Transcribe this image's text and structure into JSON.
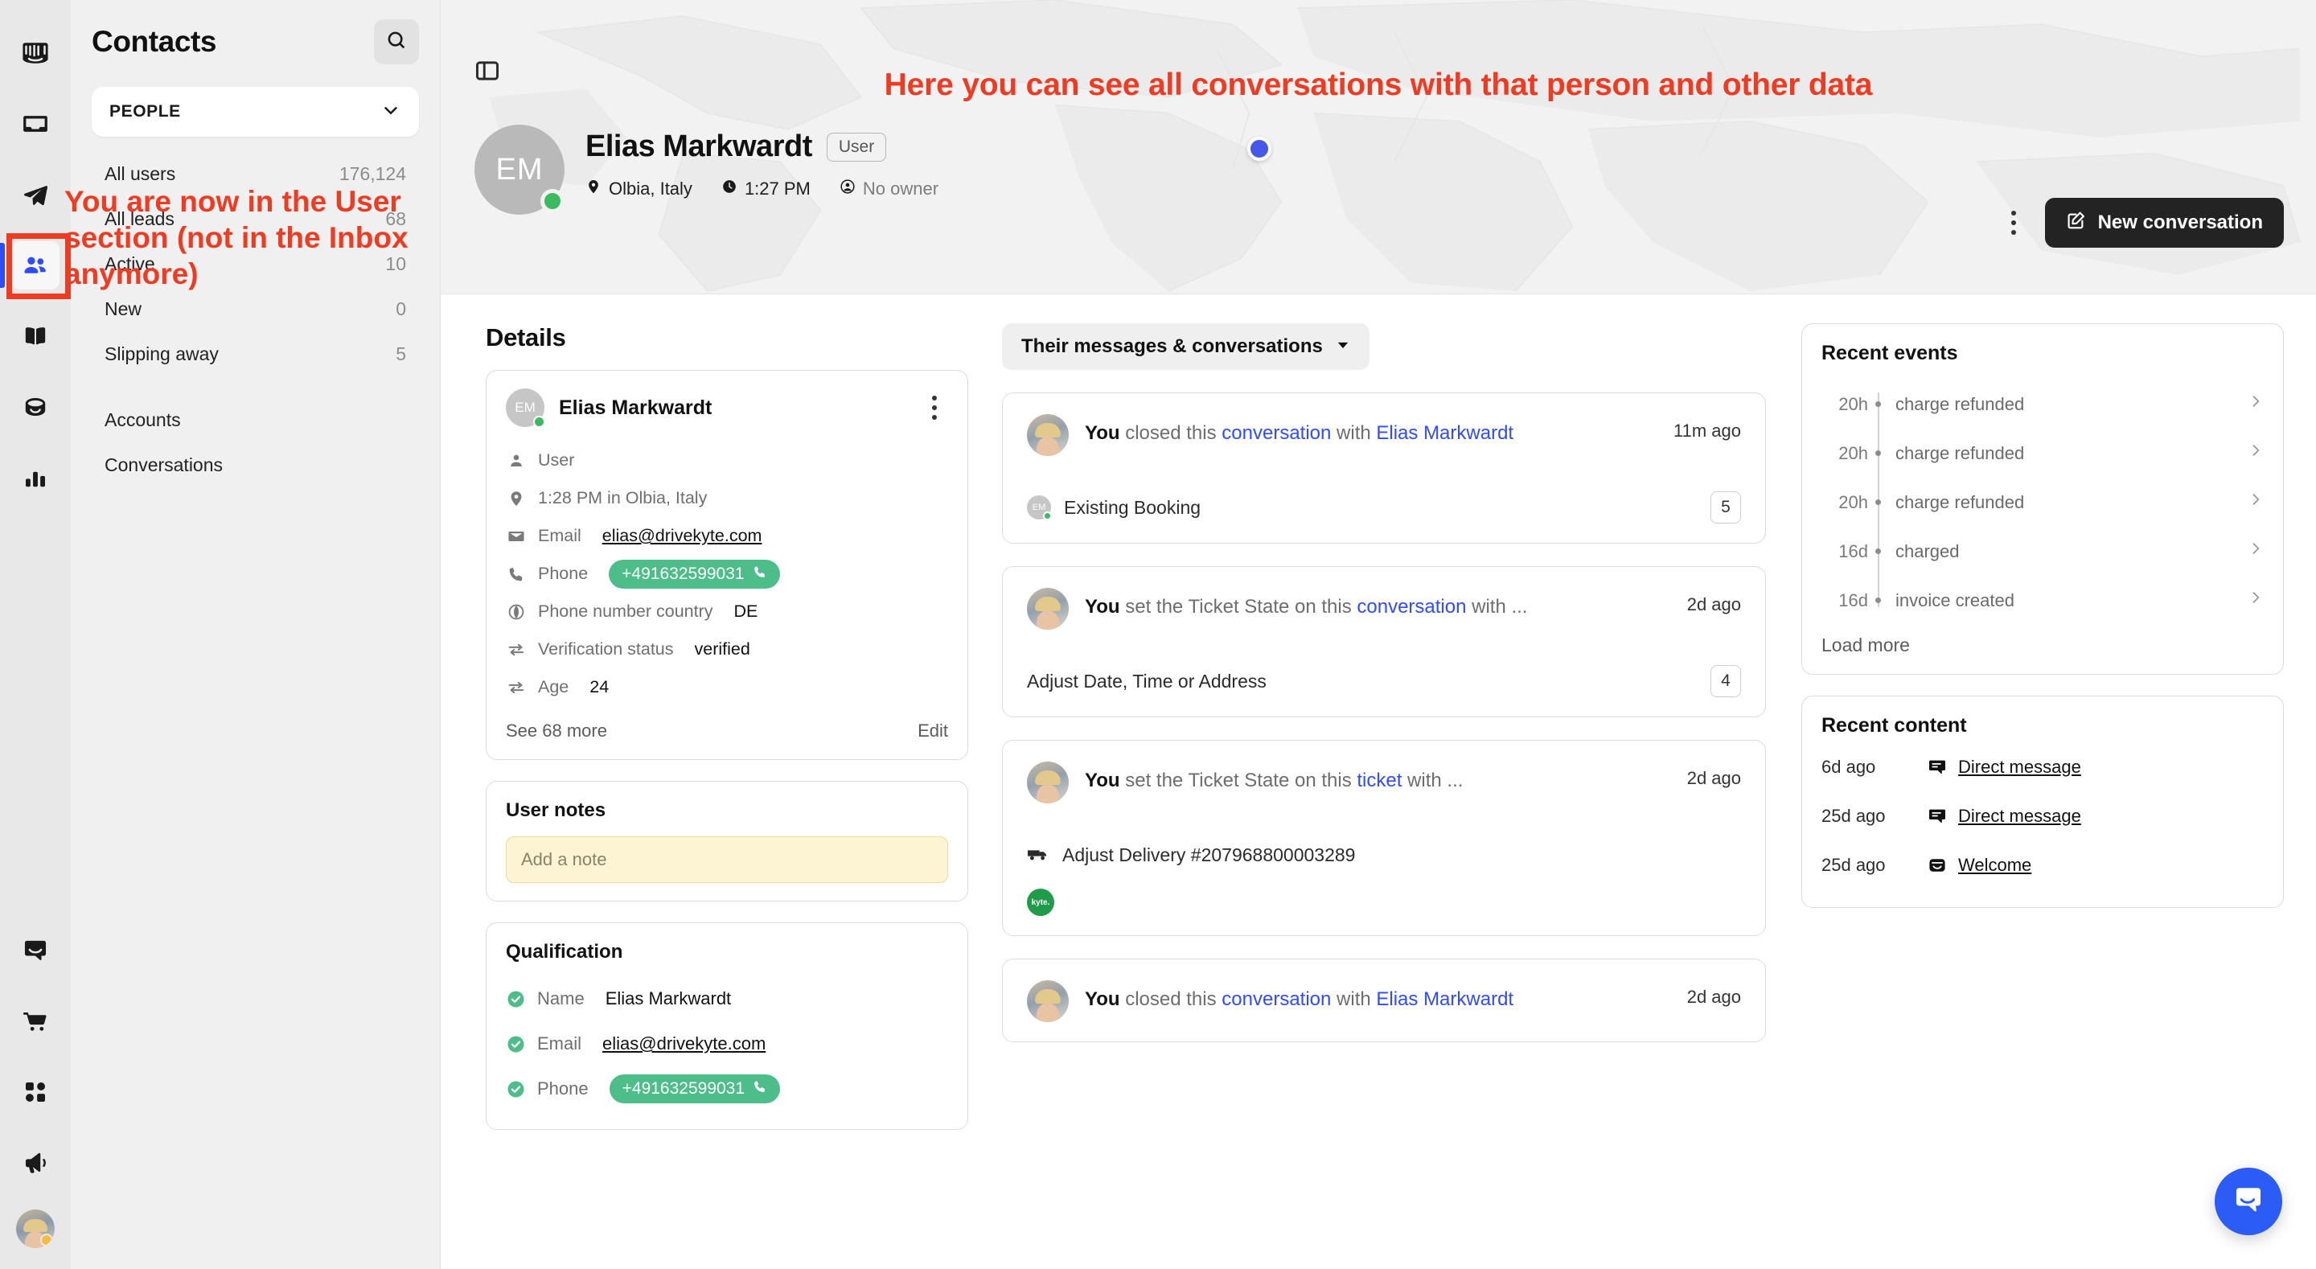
{
  "rail": {
    "items": [
      {
        "name": "intercom-logo",
        "icon": "intercom-logo-icon"
      },
      {
        "name": "inbox",
        "icon": "inbox-icon"
      },
      {
        "name": "send",
        "icon": "paper-plane-icon"
      },
      {
        "name": "contacts",
        "icon": "people-icon"
      },
      {
        "name": "knowledge",
        "icon": "book-icon"
      },
      {
        "name": "fin",
        "icon": "fin-icon"
      },
      {
        "name": "reports",
        "icon": "bar-chart-icon"
      },
      {
        "name": "messenger",
        "icon": "chat-icon"
      },
      {
        "name": "commerce",
        "icon": "cart-icon"
      },
      {
        "name": "apps",
        "icon": "apps-grid-icon"
      },
      {
        "name": "news",
        "icon": "megaphone-icon"
      }
    ],
    "active_index": 3,
    "avatar_status_color": "#f5bd3f"
  },
  "sidebar": {
    "title": "Contacts",
    "search_icon": "search-icon",
    "select": {
      "label": "PEOPLE",
      "chevron": "chevron-down-icon"
    },
    "segments": [
      {
        "label": "All users",
        "count": "176,124"
      },
      {
        "label": "All leads",
        "count": "68"
      },
      {
        "label": "Active",
        "count": "10"
      },
      {
        "label": "New",
        "count": "0"
      },
      {
        "label": "Slipping away",
        "count": "5"
      }
    ],
    "links": [
      {
        "label": "Accounts"
      },
      {
        "label": "Conversations"
      }
    ]
  },
  "annotations": {
    "left": "You are now in the User section (not in the Inbox anymore)",
    "top": "Here you can see all conversations with that person and other data",
    "color": "#ef3b22"
  },
  "hero": {
    "panel_toggle_icon": "panel-toggle-icon",
    "avatar_initials": "EM",
    "name": "Elias Markwardt",
    "tag": "User",
    "location": "Olbia, Italy",
    "time": "1:27 PM",
    "owner": "No owner",
    "location_icon": "map-pin-icon",
    "clock_icon": "clock-icon",
    "owner_icon": "person-circle-icon",
    "kebab_icon": "more-vertical-icon",
    "new_conversation_label": "New conversation",
    "new_conversation_icon": "compose-icon",
    "map_pin_color": "#4558e8",
    "status_color": "#3cba5f"
  },
  "details": {
    "title": "Details",
    "card": {
      "avatar_initials": "EM",
      "name": "Elias Markwardt",
      "kebab_icon": "more-vertical-icon",
      "rows": [
        {
          "icon": "person-icon",
          "label": "User",
          "value": "",
          "type": "plain"
        },
        {
          "icon": "map-pin-icon",
          "label": "1:28 PM in Olbia, Italy",
          "value": "",
          "type": "plain"
        },
        {
          "icon": "envelope-icon",
          "label": "Email",
          "value": "elias@drivekyte.com",
          "type": "link"
        },
        {
          "icon": "phone-icon",
          "label": "Phone",
          "value": "+491632599031",
          "type": "pill"
        },
        {
          "icon": "globe-icon",
          "label": "Phone number country",
          "value": "DE",
          "type": "value"
        },
        {
          "icon": "swap-icon",
          "label": "Verification status",
          "value": "verified",
          "type": "value"
        },
        {
          "icon": "swap-icon",
          "label": "Age",
          "value": "24",
          "type": "value"
        }
      ],
      "see_more": "See 68 more",
      "edit": "Edit"
    },
    "notes": {
      "title": "User notes",
      "placeholder": "Add a note"
    },
    "qualification": {
      "title": "Qualification",
      "rows": [
        {
          "label": "Name",
          "value": "Elias Markwardt",
          "type": "value"
        },
        {
          "label": "Email",
          "value": "elias@drivekyte.com",
          "type": "link"
        },
        {
          "label": "Phone",
          "value": "+491632599031",
          "type": "pill"
        }
      ]
    }
  },
  "conversations": {
    "filter_label": "Their messages & conversations",
    "filter_icon": "chevron-down-icon",
    "items": [
      {
        "actor": "You",
        "action_pre": " closed this ",
        "link1": "conversation",
        "action_mid": " with ",
        "link2": "Elias Markwardt",
        "action_post": "",
        "time": "11m ago",
        "subject": "Existing Booking",
        "subject_icon": "contact-avatar",
        "badge": "5"
      },
      {
        "actor": "You",
        "action_pre": " set the Ticket State on this ",
        "link1": "conversation",
        "action_mid": " with ...",
        "link2": "",
        "action_post": "",
        "time": "2d ago",
        "subject": "Adjust Date, Time or Address",
        "subject_icon": "none",
        "badge": "4"
      },
      {
        "actor": "You",
        "action_pre": " set the Ticket State on this ",
        "link1": "ticket",
        "action_mid": " with ...",
        "link2": "",
        "action_post": "",
        "time": "2d ago",
        "subject": "Adjust Delivery #207968800003289",
        "subject_icon": "delivery-icon",
        "badge": "",
        "company_badge": "kyte."
      },
      {
        "actor": "You",
        "action_pre": " closed this ",
        "link1": "conversation",
        "action_mid": " with ",
        "link2": "Elias Markwardt",
        "action_post": "",
        "time": "2d ago",
        "subject": "",
        "subject_icon": "none",
        "badge": ""
      }
    ]
  },
  "recent_events": {
    "title": "Recent events",
    "items": [
      {
        "time": "20h",
        "label": "charge refunded"
      },
      {
        "time": "20h",
        "label": "charge refunded"
      },
      {
        "time": "20h",
        "label": "charge refunded"
      },
      {
        "time": "16d",
        "label": "charged"
      },
      {
        "time": "16d",
        "label": "invoice created"
      }
    ],
    "load_more": "Load more",
    "chevron_icon": "chevron-right-icon"
  },
  "recent_content": {
    "title": "Recent content",
    "items": [
      {
        "time": "6d ago",
        "label": "Direct message",
        "icon": "message-icon"
      },
      {
        "time": "25d ago",
        "label": "Direct message",
        "icon": "message-icon"
      },
      {
        "time": "25d ago",
        "label": "Welcome",
        "icon": "fin-icon"
      }
    ]
  },
  "messenger_bubble": {
    "icon": "intercom-chat-icon",
    "color": "#2b5cf6"
  }
}
